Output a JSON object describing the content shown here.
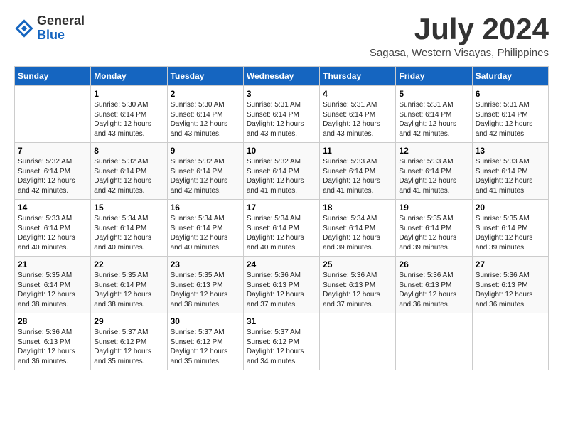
{
  "logo": {
    "general": "General",
    "blue": "Blue"
  },
  "title": "July 2024",
  "location": "Sagasa, Western Visayas, Philippines",
  "days_of_week": [
    "Sunday",
    "Monday",
    "Tuesday",
    "Wednesday",
    "Thursday",
    "Friday",
    "Saturday"
  ],
  "weeks": [
    [
      {
        "day": "",
        "info": ""
      },
      {
        "day": "1",
        "info": "Sunrise: 5:30 AM\nSunset: 6:14 PM\nDaylight: 12 hours\nand 43 minutes."
      },
      {
        "day": "2",
        "info": "Sunrise: 5:30 AM\nSunset: 6:14 PM\nDaylight: 12 hours\nand 43 minutes."
      },
      {
        "day": "3",
        "info": "Sunrise: 5:31 AM\nSunset: 6:14 PM\nDaylight: 12 hours\nand 43 minutes."
      },
      {
        "day": "4",
        "info": "Sunrise: 5:31 AM\nSunset: 6:14 PM\nDaylight: 12 hours\nand 43 minutes."
      },
      {
        "day": "5",
        "info": "Sunrise: 5:31 AM\nSunset: 6:14 PM\nDaylight: 12 hours\nand 42 minutes."
      },
      {
        "day": "6",
        "info": "Sunrise: 5:31 AM\nSunset: 6:14 PM\nDaylight: 12 hours\nand 42 minutes."
      }
    ],
    [
      {
        "day": "7",
        "info": "Sunrise: 5:32 AM\nSunset: 6:14 PM\nDaylight: 12 hours\nand 42 minutes."
      },
      {
        "day": "8",
        "info": "Sunrise: 5:32 AM\nSunset: 6:14 PM\nDaylight: 12 hours\nand 42 minutes."
      },
      {
        "day": "9",
        "info": "Sunrise: 5:32 AM\nSunset: 6:14 PM\nDaylight: 12 hours\nand 42 minutes."
      },
      {
        "day": "10",
        "info": "Sunrise: 5:32 AM\nSunset: 6:14 PM\nDaylight: 12 hours\nand 41 minutes."
      },
      {
        "day": "11",
        "info": "Sunrise: 5:33 AM\nSunset: 6:14 PM\nDaylight: 12 hours\nand 41 minutes."
      },
      {
        "day": "12",
        "info": "Sunrise: 5:33 AM\nSunset: 6:14 PM\nDaylight: 12 hours\nand 41 minutes."
      },
      {
        "day": "13",
        "info": "Sunrise: 5:33 AM\nSunset: 6:14 PM\nDaylight: 12 hours\nand 41 minutes."
      }
    ],
    [
      {
        "day": "14",
        "info": "Sunrise: 5:33 AM\nSunset: 6:14 PM\nDaylight: 12 hours\nand 40 minutes."
      },
      {
        "day": "15",
        "info": "Sunrise: 5:34 AM\nSunset: 6:14 PM\nDaylight: 12 hours\nand 40 minutes."
      },
      {
        "day": "16",
        "info": "Sunrise: 5:34 AM\nSunset: 6:14 PM\nDaylight: 12 hours\nand 40 minutes."
      },
      {
        "day": "17",
        "info": "Sunrise: 5:34 AM\nSunset: 6:14 PM\nDaylight: 12 hours\nand 40 minutes."
      },
      {
        "day": "18",
        "info": "Sunrise: 5:34 AM\nSunset: 6:14 PM\nDaylight: 12 hours\nand 39 minutes."
      },
      {
        "day": "19",
        "info": "Sunrise: 5:35 AM\nSunset: 6:14 PM\nDaylight: 12 hours\nand 39 minutes."
      },
      {
        "day": "20",
        "info": "Sunrise: 5:35 AM\nSunset: 6:14 PM\nDaylight: 12 hours\nand 39 minutes."
      }
    ],
    [
      {
        "day": "21",
        "info": "Sunrise: 5:35 AM\nSunset: 6:14 PM\nDaylight: 12 hours\nand 38 minutes."
      },
      {
        "day": "22",
        "info": "Sunrise: 5:35 AM\nSunset: 6:14 PM\nDaylight: 12 hours\nand 38 minutes."
      },
      {
        "day": "23",
        "info": "Sunrise: 5:35 AM\nSunset: 6:13 PM\nDaylight: 12 hours\nand 38 minutes."
      },
      {
        "day": "24",
        "info": "Sunrise: 5:36 AM\nSunset: 6:13 PM\nDaylight: 12 hours\nand 37 minutes."
      },
      {
        "day": "25",
        "info": "Sunrise: 5:36 AM\nSunset: 6:13 PM\nDaylight: 12 hours\nand 37 minutes."
      },
      {
        "day": "26",
        "info": "Sunrise: 5:36 AM\nSunset: 6:13 PM\nDaylight: 12 hours\nand 36 minutes."
      },
      {
        "day": "27",
        "info": "Sunrise: 5:36 AM\nSunset: 6:13 PM\nDaylight: 12 hours\nand 36 minutes."
      }
    ],
    [
      {
        "day": "28",
        "info": "Sunrise: 5:36 AM\nSunset: 6:13 PM\nDaylight: 12 hours\nand 36 minutes."
      },
      {
        "day": "29",
        "info": "Sunrise: 5:37 AM\nSunset: 6:12 PM\nDaylight: 12 hours\nand 35 minutes."
      },
      {
        "day": "30",
        "info": "Sunrise: 5:37 AM\nSunset: 6:12 PM\nDaylight: 12 hours\nand 35 minutes."
      },
      {
        "day": "31",
        "info": "Sunrise: 5:37 AM\nSunset: 6:12 PM\nDaylight: 12 hours\nand 34 minutes."
      },
      {
        "day": "",
        "info": ""
      },
      {
        "day": "",
        "info": ""
      },
      {
        "day": "",
        "info": ""
      }
    ]
  ]
}
